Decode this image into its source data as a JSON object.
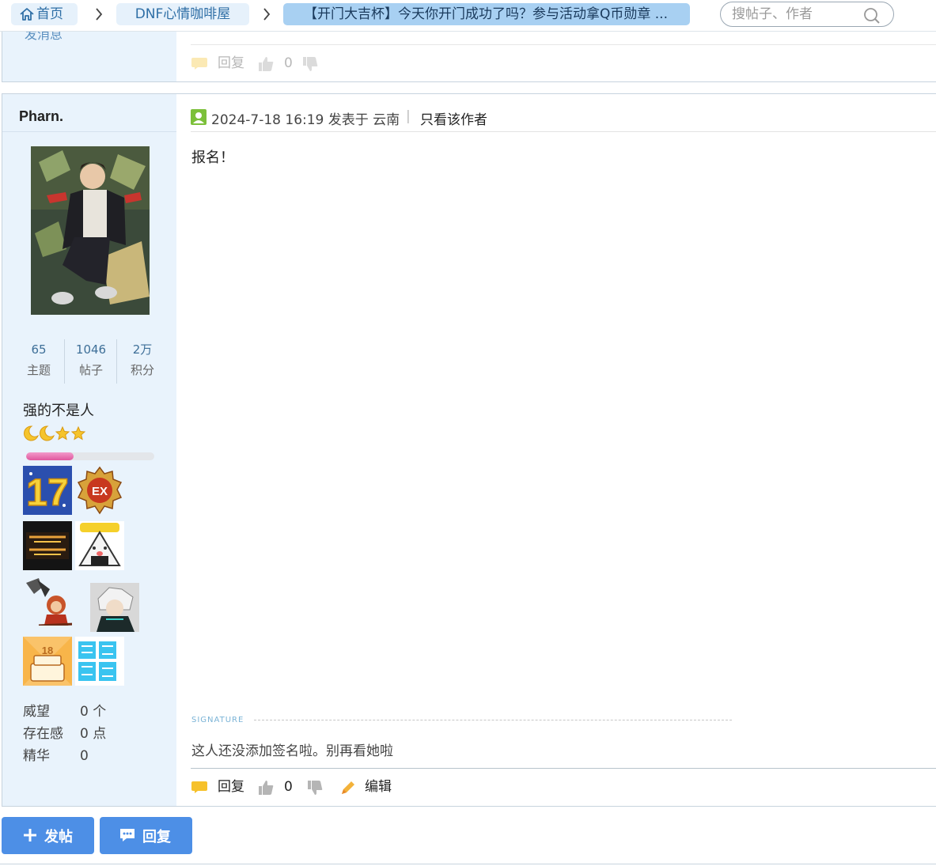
{
  "breadcrumb": {
    "home": "首页",
    "forum": "DNF心情咖啡屋",
    "thread": "【开门大吉杯】今天你开门成功了吗？参与活动拿Q币勋章 ..."
  },
  "search": {
    "placeholder": "搜帖子、作者"
  },
  "prev_post": {
    "cut_text": "发消息",
    "reply_label": "回复",
    "like_count": "0"
  },
  "post": {
    "username": "Pharn.",
    "stats": [
      {
        "value": "65",
        "label": "主题"
      },
      {
        "value": "1046",
        "label": "帖子"
      },
      {
        "value": "2万",
        "label": "积分"
      }
    ],
    "user_title": "强的不是人",
    "level_progress": 0.37,
    "meta": [
      {
        "key": "威望",
        "value": "0 个"
      },
      {
        "key": "存在感",
        "value": "0 点"
      },
      {
        "key": "精华",
        "value": "0"
      }
    ],
    "time": "2024-7-18 16:19 发表于 云南",
    "only_author": "只看该作者",
    "content": "报名！",
    "signature_label": "SIGNATURE",
    "signature": "这人还没添加签名啦。别再看她啦",
    "reply_label": "回复",
    "like_count": "0",
    "edit_label": "编辑"
  },
  "buttons": {
    "post": "发帖",
    "reply": "回复"
  },
  "colors": {
    "accent": "#4d8fe6",
    "sidebar": "#e9f3fc",
    "crumb_active": "#a8d0f2"
  }
}
